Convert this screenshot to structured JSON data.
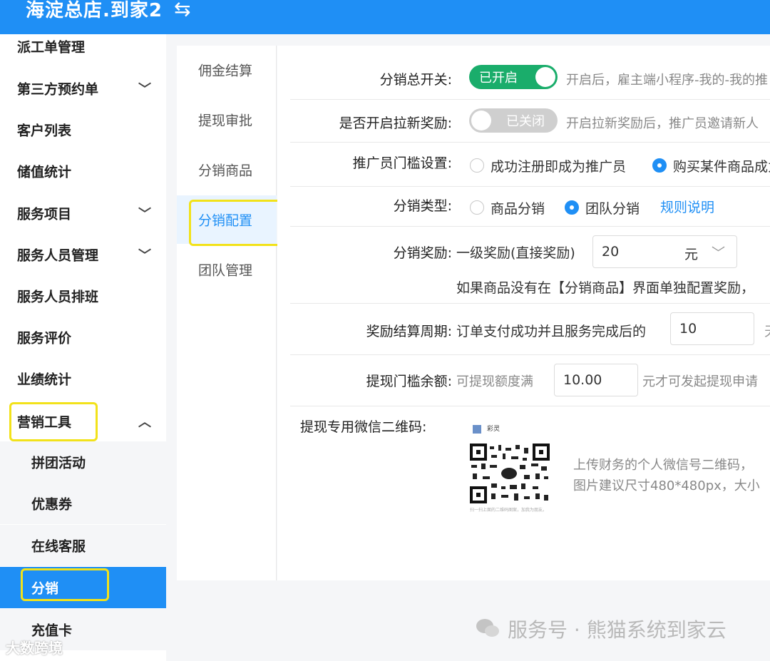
{
  "header": {
    "title": "海淀总店.到家2",
    "switch_icon": "⇆"
  },
  "sidebar": {
    "items": [
      {
        "label": "派工单管理",
        "chevron": ""
      },
      {
        "label": "第三方预约单",
        "chevron": "﹀"
      },
      {
        "label": "客户列表",
        "chevron": ""
      },
      {
        "label": "储值统计",
        "chevron": ""
      },
      {
        "label": "服务项目",
        "chevron": "﹀"
      },
      {
        "label": "服务人员管理",
        "chevron": "﹀"
      },
      {
        "label": "服务人员排班",
        "chevron": ""
      },
      {
        "label": "服务评价",
        "chevron": ""
      },
      {
        "label": "业绩统计",
        "chevron": ""
      },
      {
        "label": "营销工具",
        "chevron": "︿"
      }
    ],
    "subitems": [
      {
        "label": "拼团活动"
      },
      {
        "label": "优惠券"
      },
      {
        "label": "在线客服"
      },
      {
        "label": "分销"
      },
      {
        "label": "充值卡"
      }
    ]
  },
  "subnav": {
    "items": [
      {
        "label": "佣金结算"
      },
      {
        "label": "提现审批"
      },
      {
        "label": "分销商品"
      },
      {
        "label": "分销配置"
      },
      {
        "label": "团队管理"
      }
    ]
  },
  "form": {
    "master_switch": {
      "label": "分销总开关:",
      "state": "已开启",
      "hint": "开启后，雇主端小程序-我的-我的推"
    },
    "referral_switch": {
      "label": "是否开启拉新奖励:",
      "state": "已关闭",
      "hint": "开启拉新奖励后，推广员邀请新人"
    },
    "threshold": {
      "label": "推广员门槛设置:",
      "option1": "成功注册即成为推广员",
      "option2": "购买某件商品成为"
    },
    "dist_type": {
      "label": "分销类型:",
      "option1": "商品分销",
      "option2": "团队分销",
      "link": "规则说明"
    },
    "reward": {
      "label": "分销奖励:",
      "level1": "一级奖励(直接奖励)",
      "value": "20",
      "unit": "元",
      "unit_arrow": "﹀",
      "note": "如果商品没有在【分销商品】界面单独配置奖励，"
    },
    "period": {
      "label": "奖励结算周期:",
      "prefix": "订单支付成功并且服务完成后的",
      "value": "10",
      "suffix": "天"
    },
    "withdraw_min": {
      "label": "提现门槛余额:",
      "prefix": "可提现额度满",
      "value": "10.00",
      "suffix": "元才可发起提现申请"
    },
    "qrcode": {
      "label": "提现专用微信二维码:",
      "qr_name": "彩灵",
      "qr_caption": "扫一扫上面的二维码图案，加我为朋友。",
      "hint1": "上传财务的个人微信号二维码，",
      "hint2": "图片建议尺寸480*480px，大小"
    }
  },
  "watermark": {
    "text": "服务号 · 熊猫系统到家云",
    "badge": "大数跨境"
  },
  "colors": {
    "primary": "#1f8ff5",
    "toggle_on": "#1aad6b",
    "highlight": "#f2e21a"
  }
}
